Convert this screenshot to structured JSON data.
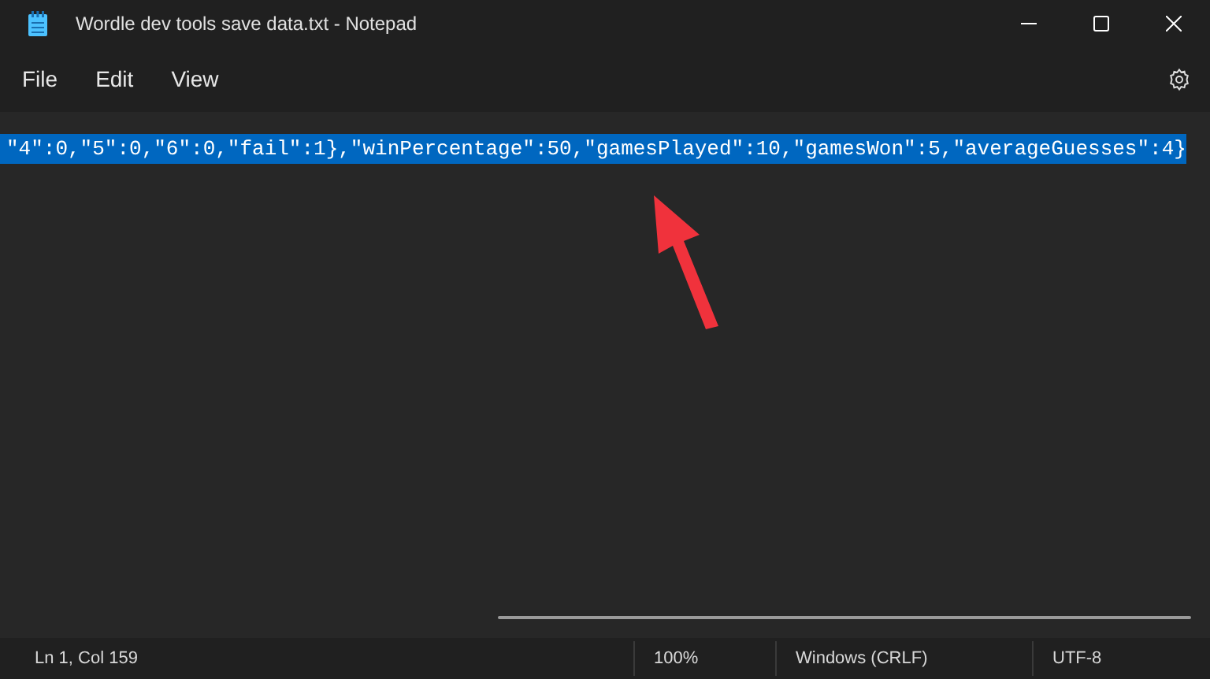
{
  "window": {
    "title": "Wordle dev tools save data.txt - Notepad"
  },
  "menu": [
    "File",
    "Edit",
    "View"
  ],
  "editor": {
    "lines": [
      {
        "text": "\"4\":0,\"5\":0,\"6\":0,\"fail\":1},\"winPercentage\":50,\"gamesPlayed\":10,\"gamesWon\":5,\"averageGuesses\":4}",
        "selected": true
      }
    ]
  },
  "status_bar": [
    "Ln 1, Col 159",
    "100%",
    "Windows (CRLF)",
    "UTF-8"
  ]
}
